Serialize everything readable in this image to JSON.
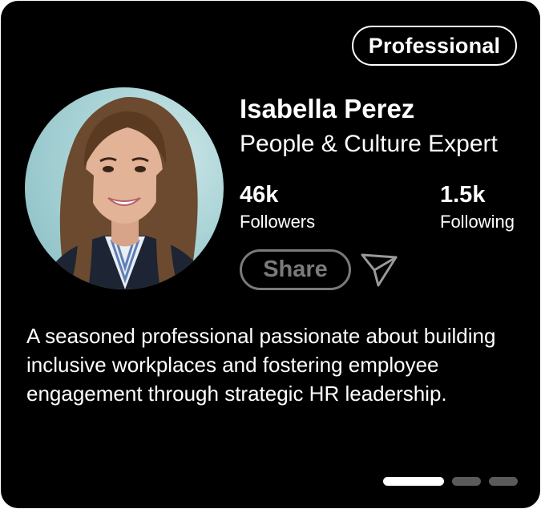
{
  "badge": {
    "label": "Professional"
  },
  "profile": {
    "name": "Isabella Perez",
    "title": "People & Culture Expert",
    "avatar_alt": "profile-photo"
  },
  "stats": [
    {
      "value": "46k",
      "label": "Followers"
    },
    {
      "value": "1.5k",
      "label": "Following"
    }
  ],
  "actions": {
    "share_label": "Share",
    "send_icon": "paper-plane-icon"
  },
  "bio": "A seasoned professional passionate about building inclusive workplaces and fostering employee engagement through strategic HR leadership.",
  "pagination": {
    "total": 3,
    "active": 1
  },
  "colors": {
    "card_bg": "#000000",
    "text": "#ffffff",
    "muted": "#7a7a7a",
    "dot_inactive": "#5a5a5a"
  }
}
